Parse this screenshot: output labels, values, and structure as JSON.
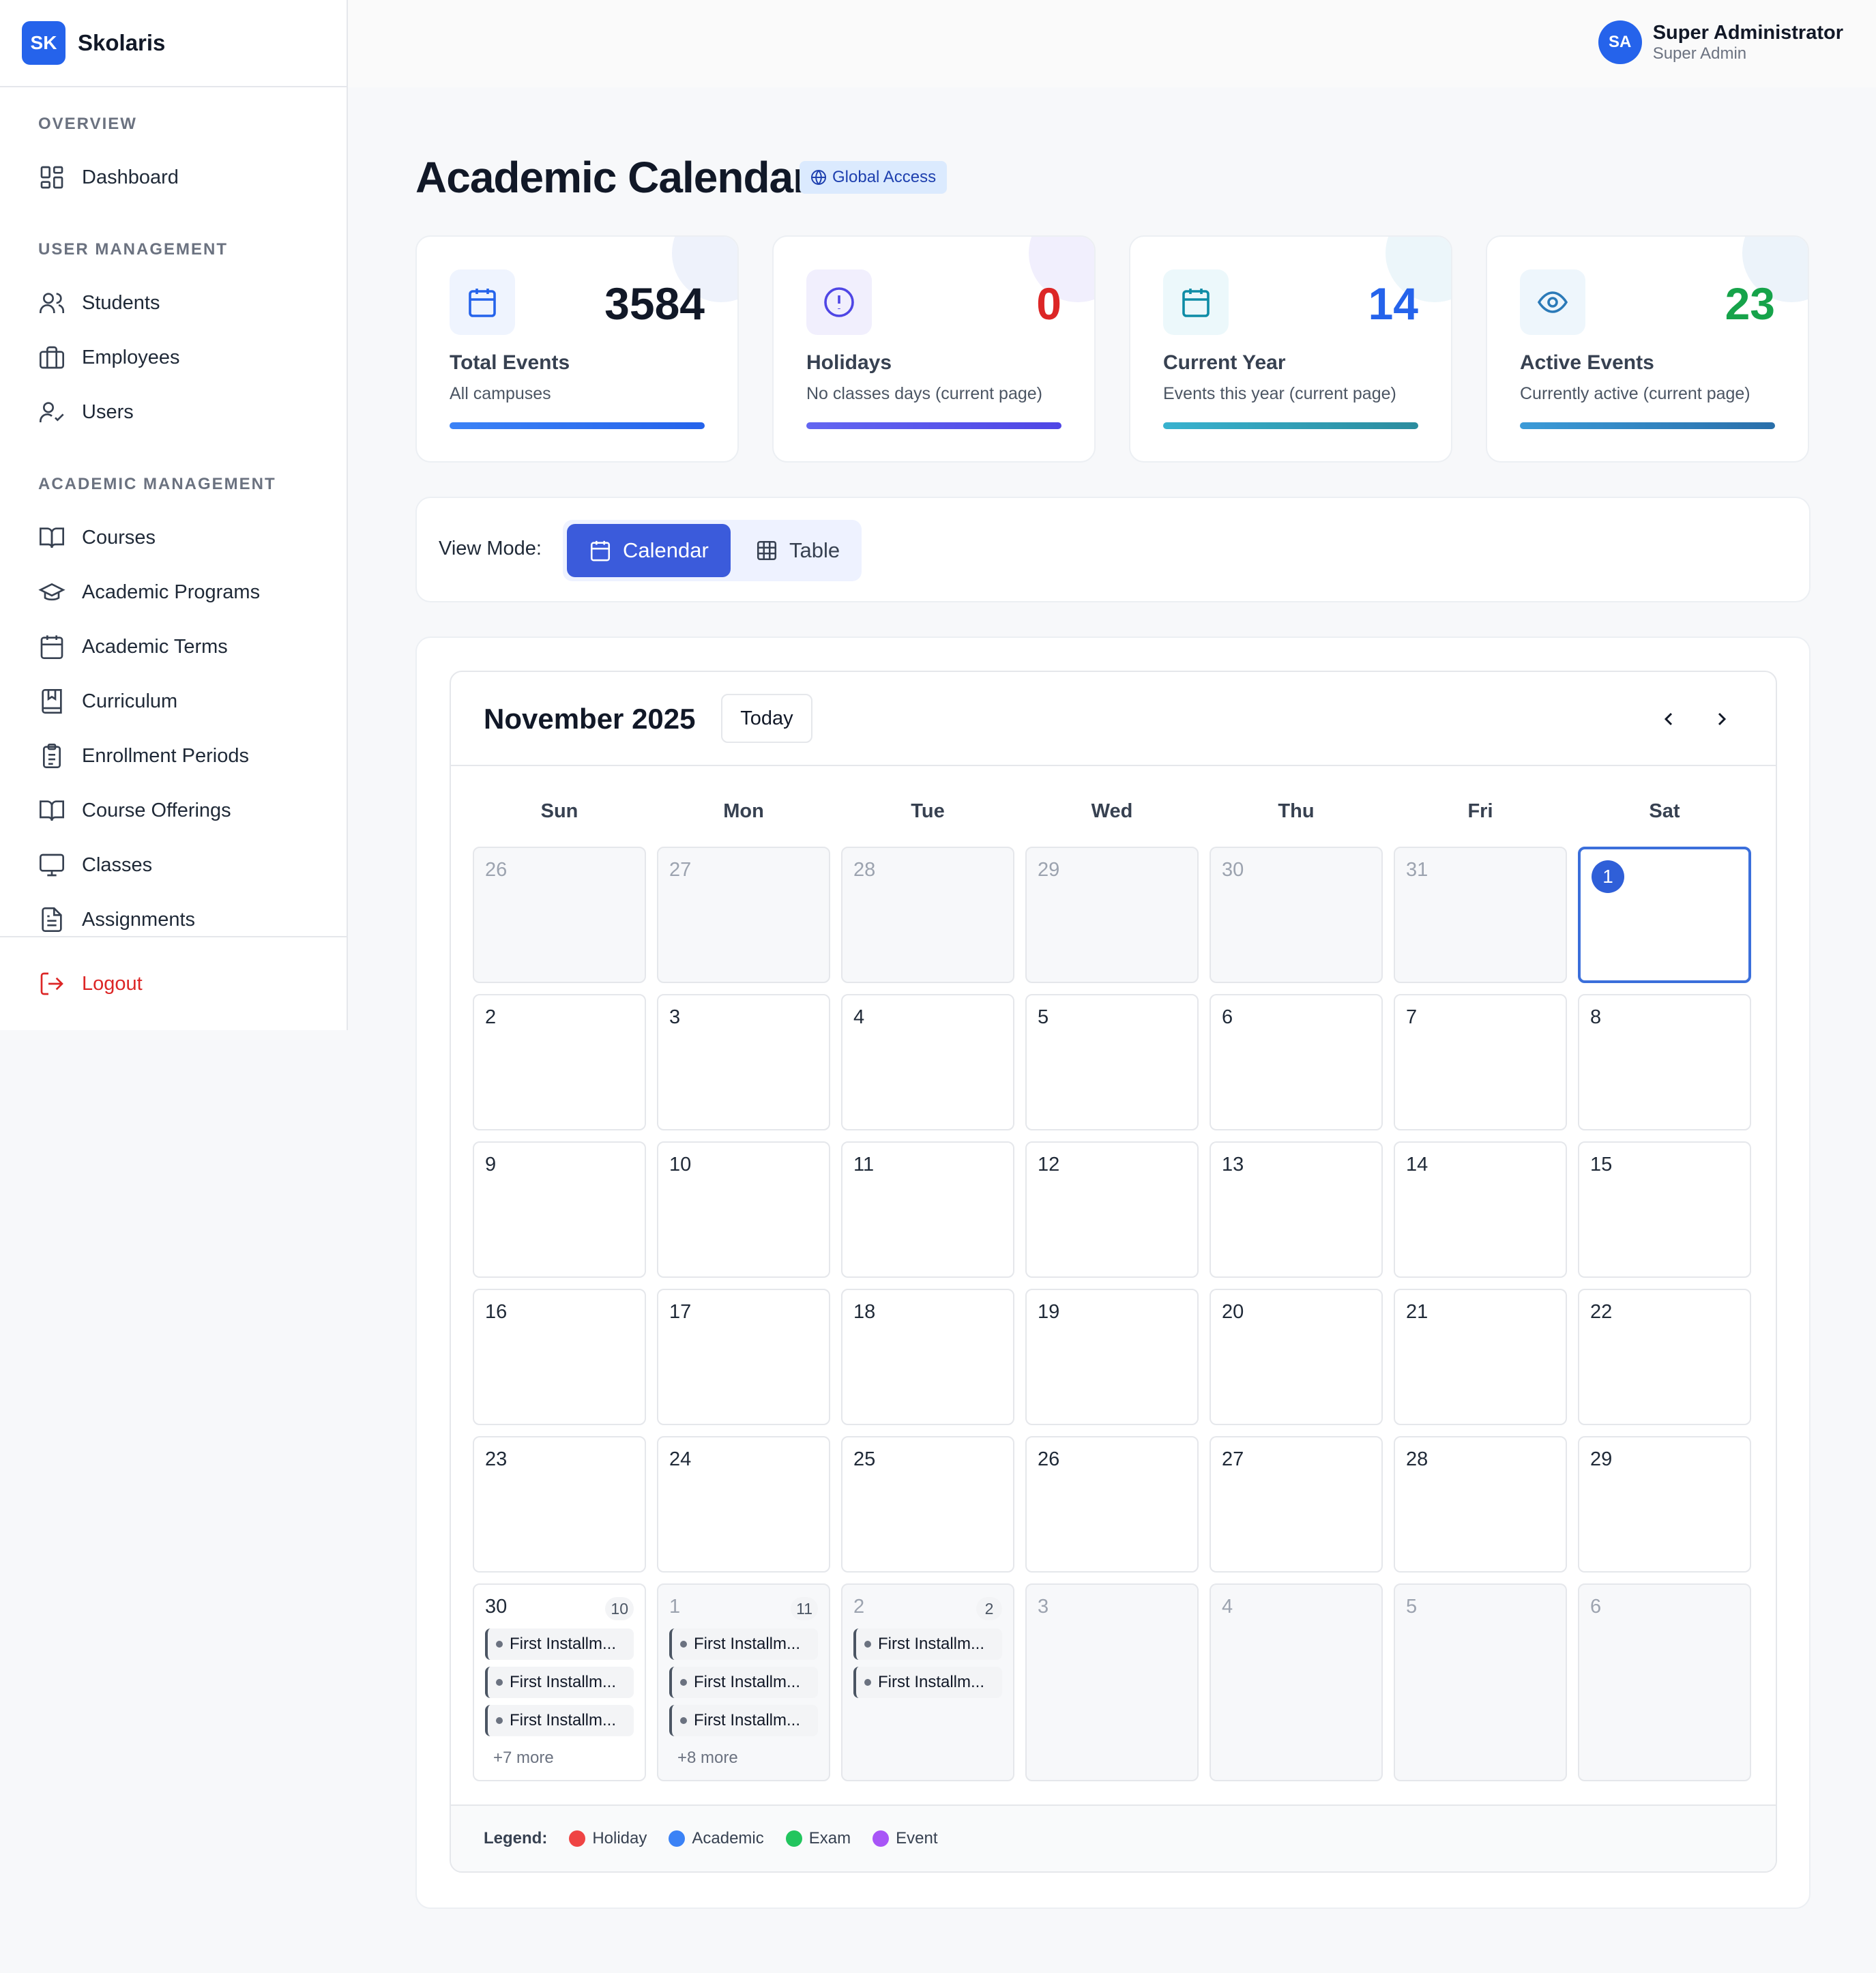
{
  "app": {
    "logo": "SK",
    "name": "Skolaris"
  },
  "user": {
    "initials": "SA",
    "name": "Super Administrator",
    "role": "Super Admin"
  },
  "sidebar": {
    "sections": [
      "OVERVIEW",
      "USER MANAGEMENT",
      "ACADEMIC MANAGEMENT"
    ],
    "items": [
      {
        "label": "Dashboard",
        "icon": "dashboard-icon"
      },
      {
        "label": "Students",
        "icon": "users-icon"
      },
      {
        "label": "Employees",
        "icon": "briefcase-icon"
      },
      {
        "label": "Users",
        "icon": "user-check-icon"
      },
      {
        "label": "Courses",
        "icon": "book-open-icon"
      },
      {
        "label": "Academic Programs",
        "icon": "graduation-cap-icon"
      },
      {
        "label": "Academic Terms",
        "icon": "calendar-icon"
      },
      {
        "label": "Curriculum",
        "icon": "bookmark-book-icon"
      },
      {
        "label": "Enrollment Periods",
        "icon": "clipboard-icon"
      },
      {
        "label": "Course Offerings",
        "icon": "book-open-icon"
      },
      {
        "label": "Classes",
        "icon": "monitor-icon"
      },
      {
        "label": "Assignments",
        "icon": "file-text-icon"
      }
    ],
    "logout": "Logout"
  },
  "page": {
    "title": "Academic Calendar",
    "badge": "Global Access"
  },
  "stats": [
    {
      "value": "3584",
      "label": "Total Events",
      "sub": "All campuses",
      "color": "#111827",
      "icon": "calendar-icon"
    },
    {
      "value": "0",
      "label": "Holidays",
      "sub": "No classes days (current page)",
      "color": "#dc2626",
      "icon": "alert-circle-icon"
    },
    {
      "value": "14",
      "label": "Current Year",
      "sub": "Events this year (current page)",
      "color": "#2563eb",
      "icon": "calendar-icon"
    },
    {
      "value": "23",
      "label": "Active Events",
      "sub": "Currently active (current page)",
      "color": "#16a34a",
      "icon": "eye-icon"
    }
  ],
  "view_mode": {
    "label": "View Mode:",
    "calendar": "Calendar",
    "table": "Table",
    "selected": "Calendar"
  },
  "calendar": {
    "month": "November 2025",
    "today": "Today",
    "weekdays": [
      "Sun",
      "Mon",
      "Tue",
      "Wed",
      "Thu",
      "Fri",
      "Sat"
    ],
    "weeks": [
      [
        {
          "d": "26",
          "out": true
        },
        {
          "d": "27",
          "out": true
        },
        {
          "d": "28",
          "out": true
        },
        {
          "d": "29",
          "out": true
        },
        {
          "d": "30",
          "out": true
        },
        {
          "d": "31",
          "out": true
        },
        {
          "d": "1",
          "selected": true
        }
      ],
      [
        {
          "d": "2"
        },
        {
          "d": "3"
        },
        {
          "d": "4"
        },
        {
          "d": "5"
        },
        {
          "d": "6"
        },
        {
          "d": "7"
        },
        {
          "d": "8"
        }
      ],
      [
        {
          "d": "9"
        },
        {
          "d": "10"
        },
        {
          "d": "11"
        },
        {
          "d": "12"
        },
        {
          "d": "13"
        },
        {
          "d": "14"
        },
        {
          "d": "15"
        }
      ],
      [
        {
          "d": "16"
        },
        {
          "d": "17"
        },
        {
          "d": "18"
        },
        {
          "d": "19"
        },
        {
          "d": "20"
        },
        {
          "d": "21"
        },
        {
          "d": "22"
        }
      ],
      [
        {
          "d": "23"
        },
        {
          "d": "24"
        },
        {
          "d": "25"
        },
        {
          "d": "26"
        },
        {
          "d": "27"
        },
        {
          "d": "28"
        },
        {
          "d": "29"
        }
      ],
      [
        {
          "d": "30",
          "count": "10",
          "events": [
            "First Installm...",
            "First Installm...",
            "First Installm..."
          ],
          "more": "+7 more"
        },
        {
          "d": "1",
          "out": true,
          "count": "11",
          "events": [
            "First Installm...",
            "First Installm...",
            "First Installm..."
          ],
          "more": "+8 more"
        },
        {
          "d": "2",
          "out": true,
          "count": "2",
          "events": [
            "First Installm...",
            "First Installm..."
          ]
        },
        {
          "d": "3",
          "out": true
        },
        {
          "d": "4",
          "out": true
        },
        {
          "d": "5",
          "out": true
        },
        {
          "d": "6",
          "out": true
        }
      ]
    ],
    "legend_title": "Legend:",
    "legend": [
      {
        "label": "Holiday",
        "color": "#ef4444"
      },
      {
        "label": "Academic",
        "color": "#3b82f6"
      },
      {
        "label": "Exam",
        "color": "#22c55e"
      },
      {
        "label": "Event",
        "color": "#a855f7"
      }
    ]
  }
}
